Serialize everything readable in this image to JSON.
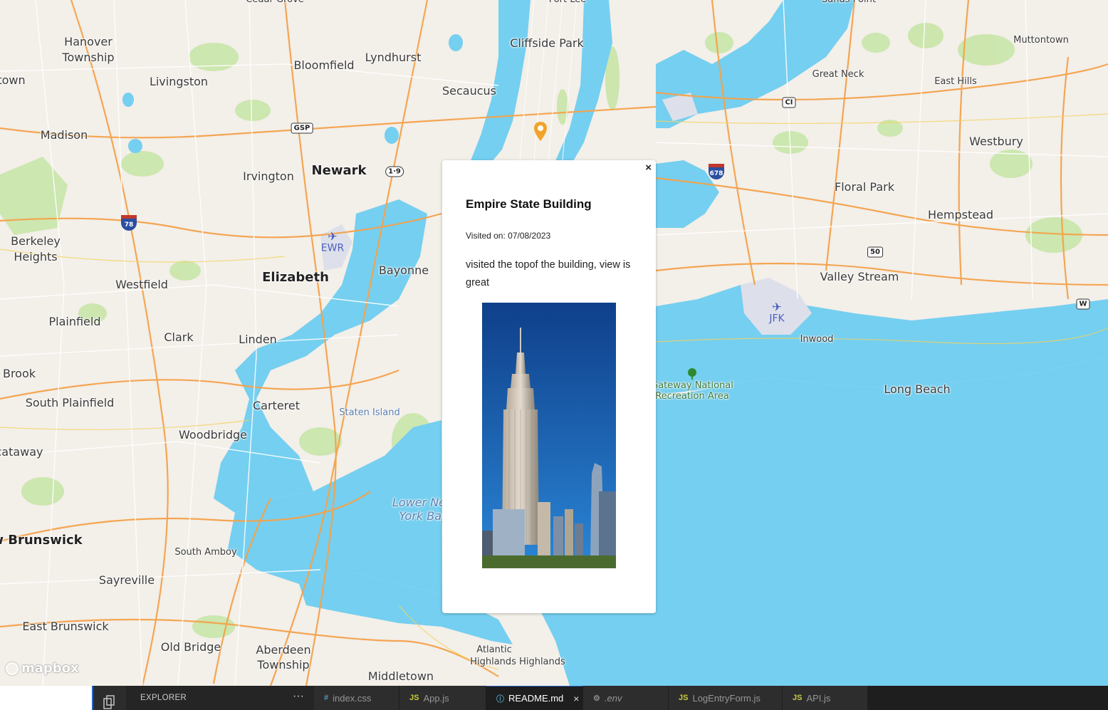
{
  "map": {
    "attribution_logo": "mapbox",
    "accent": {
      "land": "#f3efe9",
      "water": "#75cff0",
      "park": "#c8e6a8",
      "road": "#f5a24a",
      "pin": "#f2a32a"
    },
    "labels": {
      "cedar_grove": "Cedar Grove",
      "fort_lee": "Fort Lee",
      "sands_point": "Sands Point",
      "hanover_1": "Hanover",
      "hanover_2": "Township",
      "town": "town",
      "livingston": "Livingston",
      "bloomfield": "Bloomfield",
      "lyndhurst": "Lyndhurst",
      "cliffside_park": "Cliffside Park",
      "secaucus": "Secaucus",
      "muttontown": "Muttontown",
      "great_neck": "Great Neck",
      "east_hills": "East Hills",
      "madison": "Madison",
      "westbury": "Westbury",
      "irvington": "Irvington",
      "newark": "Newark",
      "floral_park": "Floral Park",
      "hempstead": "Hempstead",
      "berkeley_1": "Berkeley",
      "berkeley_2": "Heights",
      "elizabeth": "Elizabeth",
      "bayonne": "Bayonne",
      "valley_stream": "Valley Stream",
      "westfield": "Westfield",
      "plainfield": "Plainfield",
      "clark": "Clark",
      "linden": "Linden",
      "inwood": "Inwood",
      "brook": "Brook",
      "gateway_1": "Gateway National",
      "gateway_2": "Recreation Area",
      "long_beach": "Long Beach",
      "south_plainfield": "South Plainfield",
      "carteret": "Carteret",
      "staten_island": "Staten Island",
      "woodbridge": "Woodbridge",
      "cataway": "cataway",
      "lower_ny_1": "Lower New",
      "lower_ny_2": "York Bay",
      "new_brunswick": "w Brunswick",
      "south_amboy": "South Amboy",
      "sayreville": "Sayreville",
      "east_brunswick": "East Brunswick",
      "old_bridge": "Old Bridge",
      "aberdeen_1": "Aberdeen",
      "aberdeen_2": "Township",
      "atlantic_1": "Atlantic",
      "atlantic_2": "Highlands Highlands",
      "middletown": "Middletown"
    },
    "shields": {
      "gsp": "GSP",
      "us19": "1·9",
      "i78": "78",
      "i678": "678",
      "ci": "CI",
      "r50": "50",
      "w": "W"
    },
    "airports": {
      "ewr": "EWR",
      "jfk": "JFK"
    }
  },
  "popup": {
    "close_label": "×",
    "title": "Empire State Building",
    "visited": "Visited on: 07/08/2023",
    "comment": "visited the topof the building, view is great",
    "image_alt": "Empire State Building photo"
  },
  "editor": {
    "explorer_title": "EXPLORER",
    "explorer_more": "···",
    "tabs": [
      {
        "icon": "#",
        "label": "index.css"
      },
      {
        "icon": "JS",
        "label": "App.js"
      },
      {
        "icon": "ⓘ",
        "label": "README.md",
        "close": "×"
      },
      {
        "icon": "⚙",
        "label": ".env"
      },
      {
        "icon": "JS",
        "label": "LogEntryForm.js"
      },
      {
        "icon": "JS",
        "label": "API.js"
      }
    ]
  }
}
